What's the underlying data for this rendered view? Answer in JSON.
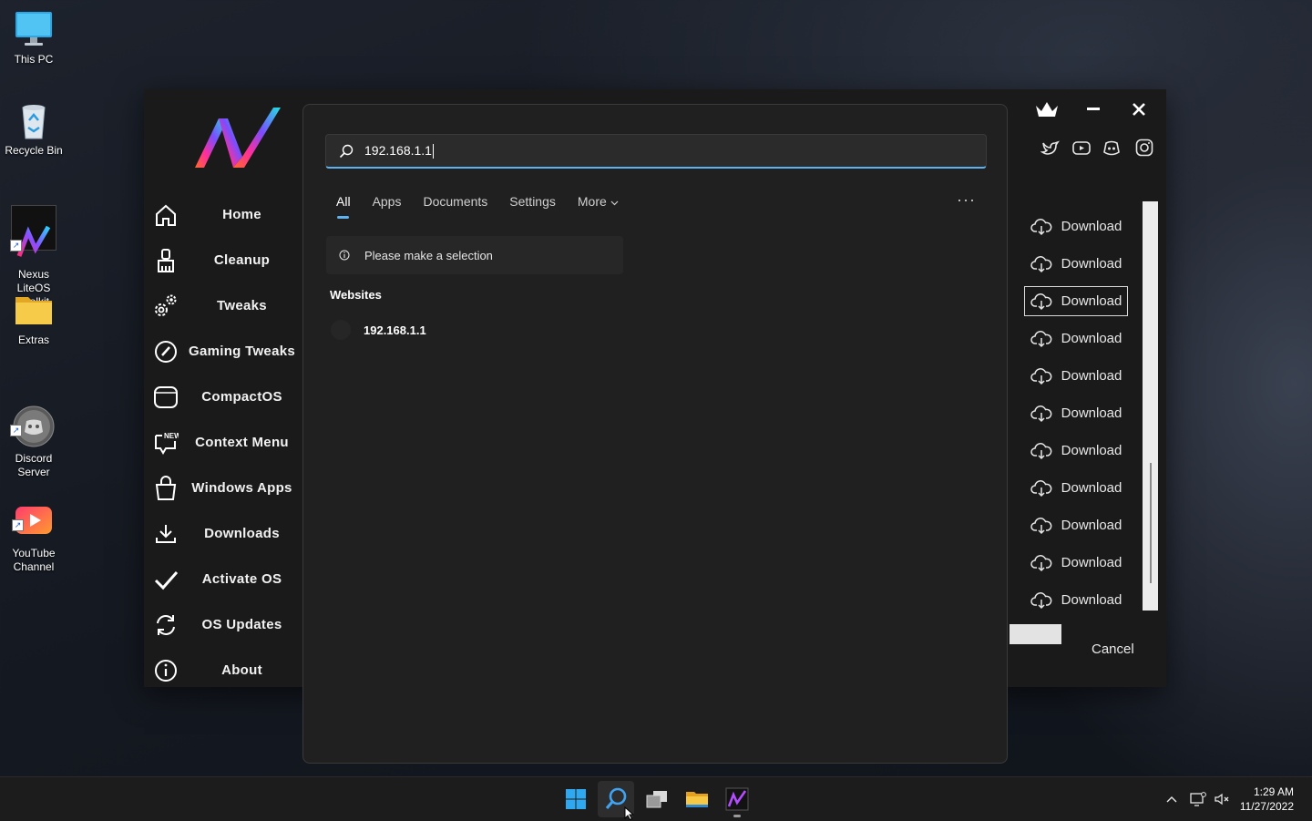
{
  "desktop": {
    "icons": [
      {
        "label": "This PC",
        "icon": "monitor-icon"
      },
      {
        "label": "Recycle Bin",
        "icon": "recycle-bin-icon"
      },
      {
        "label": "Nexus LiteOS\nToolkit",
        "icon": "nexus-logo-icon"
      },
      {
        "label": "Extras",
        "icon": "folder-icon"
      },
      {
        "label": "Discord\nServer",
        "icon": "discord-icon"
      },
      {
        "label": "YouTube\nChannel",
        "icon": "youtube-icon"
      }
    ]
  },
  "toolkit": {
    "nav": [
      {
        "label": "Home",
        "icon": "home-icon"
      },
      {
        "label": "Cleanup",
        "icon": "broom-icon"
      },
      {
        "label": "Tweaks",
        "icon": "gears-icon"
      },
      {
        "label": "Gaming Tweaks",
        "icon": "speedometer-icon"
      },
      {
        "label": "CompactOS",
        "icon": "compact-icon"
      },
      {
        "label": "Context Menu",
        "icon": "context-menu-icon",
        "badge": "NEW!"
      },
      {
        "label": "Windows Apps",
        "icon": "shopping-bag-icon"
      },
      {
        "label": "Downloads",
        "icon": "download-tray-icon"
      },
      {
        "label": "Activate OS",
        "icon": "checkmark-icon"
      },
      {
        "label": "OS Updates",
        "icon": "refresh-icon"
      },
      {
        "label": "About",
        "icon": "info-icon"
      }
    ],
    "controls": {
      "crown": "crown-icon",
      "minimize": "minimize-icon",
      "close": "close-icon"
    },
    "social": [
      "twitter-icon",
      "youtube-icon",
      "discord-icon",
      "instagram-icon"
    ],
    "download_label": "Download",
    "download_count": 11,
    "focused_index": 2,
    "cancel_label": "Cancel"
  },
  "search": {
    "query": "192.168.1.1",
    "tabs": [
      "All",
      "Apps",
      "Documents",
      "Settings",
      "More"
    ],
    "active_tab": "All",
    "info_message": "Please make a selection",
    "section_title": "Websites",
    "result": "192.168.1.1"
  },
  "taskbar": {
    "apps": [
      "windows-start-icon",
      "search-icon",
      "task-view-icon",
      "file-explorer-icon",
      "nexus-toolkit-icon"
    ],
    "time": "1:29 AM",
    "date": "11/27/2022"
  }
}
